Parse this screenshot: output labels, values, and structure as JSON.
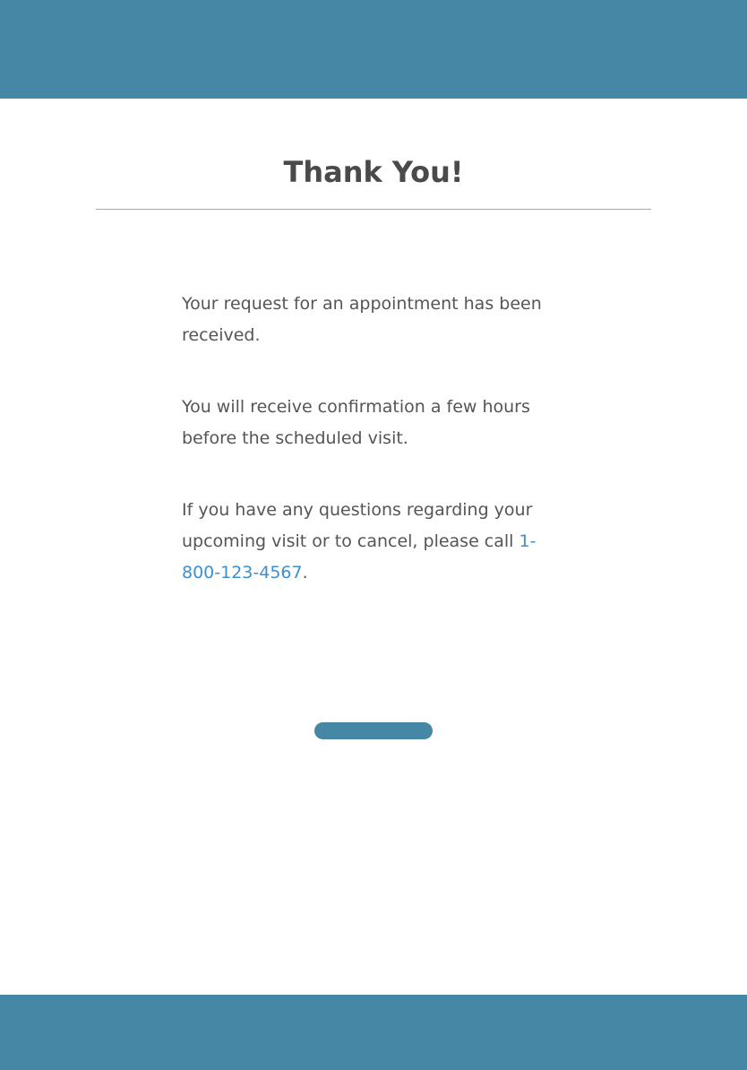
{
  "colors": {
    "brand": "#4687a6",
    "link": "#3d8fd4",
    "text": "#4a4a4a",
    "divider": "#a9a9a9"
  },
  "page": {
    "title": "Thank You!"
  },
  "messages": {
    "received": "Your request for an appointment has been received.",
    "confirmation": "You will receive confirmation a few hours before the scheduled visit.",
    "questions_prefix": "If you have any questions regarding your upcoming visit or to cancel, please call ",
    "phone": "1-800-123-4567",
    "questions_suffix": "."
  },
  "action_button": {
    "label": ""
  }
}
